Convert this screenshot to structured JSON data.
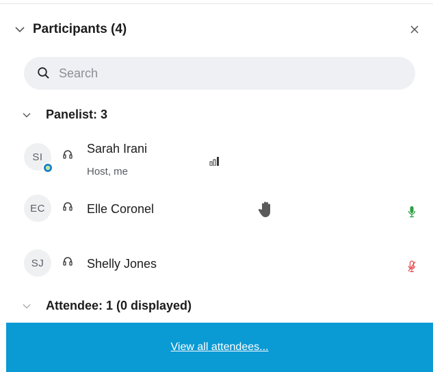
{
  "panel": {
    "title": "Participants (4)"
  },
  "search": {
    "placeholder": "Search"
  },
  "sections": {
    "panelist": "Panelist: 3",
    "attendee": "Attendee: 1 (0 displayed)"
  },
  "participants": [
    {
      "initials": "SI",
      "name": "Sarah Irani",
      "role": "Host, me"
    },
    {
      "initials": "EC",
      "name": "Elle Coronel"
    },
    {
      "initials": "SJ",
      "name": "Shelly Jones"
    }
  ],
  "footer": {
    "link": "View all attendees..."
  },
  "colors": {
    "accent": "#0a9ad4",
    "mic_on": "#2ea043",
    "mic_muted": "#e5484d"
  }
}
